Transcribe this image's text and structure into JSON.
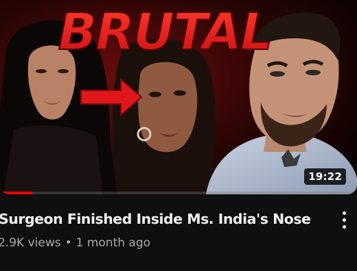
{
  "video": {
    "thumbnail_text": "BRUTAL",
    "duration": "19:22",
    "progress_fraction": 0.09,
    "title": "Surgeon Finished Inside Ms. India's Nose",
    "views": "2.9K views",
    "separator": "•",
    "age": "1 month ago",
    "menu_icon": "more-vertical-icon"
  },
  "colors": {
    "background": "#0f0f0f",
    "title_text": "#f1f1f1",
    "meta_text": "#aaaaaa",
    "accent_red": "#ff0000",
    "thumb_red": "#e0161a"
  }
}
